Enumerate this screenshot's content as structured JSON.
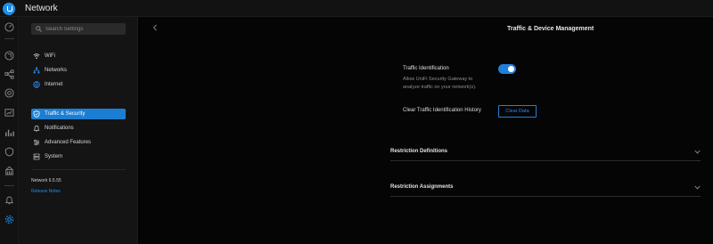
{
  "app": {
    "title": "Network"
  },
  "rail": {
    "icons": [
      "dashboard-icon",
      "clients-icon",
      "topology-icon",
      "devices-icon",
      "insights-icon",
      "statistics-icon",
      "security-shield-icon",
      "stats-building-icon",
      "notifications-bell-icon",
      "settings-gear-icon"
    ],
    "active": "settings-gear-icon"
  },
  "sidebar": {
    "search_placeholder": "Search Settings",
    "groups": [
      [
        {
          "label": "WiFi",
          "icon": "wifi-icon"
        },
        {
          "label": "Networks",
          "icon": "networks-icon"
        },
        {
          "label": "Internet",
          "icon": "globe-icon"
        }
      ],
      [
        {
          "label": "Traffic & Security",
          "icon": "shield-icon",
          "active": true
        },
        {
          "label": "Notifications",
          "icon": "bell-icon"
        },
        {
          "label": "Advanced Features",
          "icon": "sliders-icon"
        },
        {
          "label": "System",
          "icon": "system-icon"
        }
      ]
    ],
    "version": "Network 6.5.55",
    "release_notes": "Release Notes"
  },
  "main": {
    "title": "Traffic & Device Management",
    "traffic_identification": {
      "label": "Traffic Identification",
      "description": "Allow UniFi Security Gateway to analyze traffic on your network(s).",
      "enabled": true
    },
    "clear_history": {
      "label": "Clear Traffic Identification History",
      "button": "Clear Data"
    },
    "sections": [
      {
        "label": "Restriction Definitions",
        "expanded": false
      },
      {
        "label": "Restriction Assignments",
        "expanded": false
      }
    ]
  },
  "colors": {
    "accent": "#1c7ed3",
    "background": "#050505",
    "sidebar": "#141414"
  }
}
